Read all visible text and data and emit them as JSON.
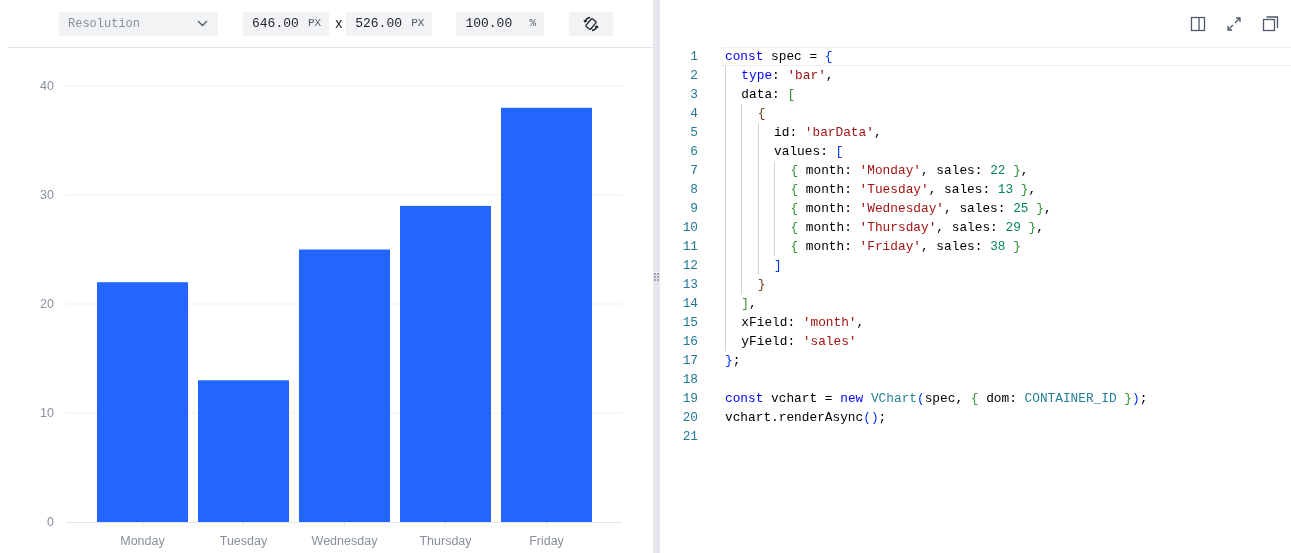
{
  "toolbar": {
    "resolution": {
      "placeholder": "Resolution"
    },
    "width": {
      "value": "646.00",
      "unit": "PX"
    },
    "separator": "x",
    "height": {
      "value": "526.00",
      "unit": "PX"
    },
    "zoom": {
      "value": "100.00",
      "unit": "%"
    }
  },
  "chart": {
    "chart_data": {
      "type": "bar",
      "categories": [
        "Monday",
        "Tuesday",
        "Wednesday",
        "Thursday",
        "Friday"
      ],
      "values": [
        22,
        13,
        25,
        29,
        38
      ],
      "ylim": [
        0,
        40
      ],
      "yticks": [
        0,
        10,
        20,
        30,
        40
      ],
      "grid": true
    }
  },
  "editor": {
    "lines": [
      {
        "number": "1",
        "active": true,
        "tokens": [
          {
            "text": "const",
            "kind": "k"
          },
          {
            "text": " spec = ",
            "kind": "p"
          },
          {
            "text": "{",
            "kind": "b1"
          }
        ]
      },
      {
        "number": "2",
        "active": false,
        "tokens": [
          {
            "text": "  type",
            "kind": "k"
          },
          {
            "text": ": ",
            "kind": "p"
          },
          {
            "text": "'bar'",
            "kind": "s"
          },
          {
            "text": ",",
            "kind": "p"
          }
        ]
      },
      {
        "number": "3",
        "active": false,
        "tokens": [
          {
            "text": "  data: ",
            "kind": "p"
          },
          {
            "text": "[",
            "kind": "b2"
          }
        ]
      },
      {
        "number": "4",
        "active": false,
        "tokens": [
          {
            "text": "    {",
            "kind": "b3"
          }
        ]
      },
      {
        "number": "5",
        "active": false,
        "tokens": [
          {
            "text": "      id: ",
            "kind": "p"
          },
          {
            "text": "'barData'",
            "kind": "s"
          },
          {
            "text": ",",
            "kind": "p"
          }
        ]
      },
      {
        "number": "6",
        "active": false,
        "tokens": [
          {
            "text": "      values: ",
            "kind": "p"
          },
          {
            "text": "[",
            "kind": "b1"
          }
        ]
      },
      {
        "number": "7",
        "active": false,
        "tokens": [
          {
            "text": "        {",
            "kind": "b2"
          },
          {
            "text": " month: ",
            "kind": "p"
          },
          {
            "text": "'Monday'",
            "kind": "s"
          },
          {
            "text": ", sales: ",
            "kind": "p"
          },
          {
            "text": "22",
            "kind": "n"
          },
          {
            "text": " }",
            "kind": "b2"
          },
          {
            "text": ",",
            "kind": "p"
          }
        ]
      },
      {
        "number": "8",
        "active": false,
        "tokens": [
          {
            "text": "        {",
            "kind": "b2"
          },
          {
            "text": " month: ",
            "kind": "p"
          },
          {
            "text": "'Tuesday'",
            "kind": "s"
          },
          {
            "text": ", sales: ",
            "kind": "p"
          },
          {
            "text": "13",
            "kind": "n"
          },
          {
            "text": " }",
            "kind": "b2"
          },
          {
            "text": ",",
            "kind": "p"
          }
        ]
      },
      {
        "number": "9",
        "active": false,
        "tokens": [
          {
            "text": "        {",
            "kind": "b2"
          },
          {
            "text": " month: ",
            "kind": "p"
          },
          {
            "text": "'Wednesday'",
            "kind": "s"
          },
          {
            "text": ", sales: ",
            "kind": "p"
          },
          {
            "text": "25",
            "kind": "n"
          },
          {
            "text": " }",
            "kind": "b2"
          },
          {
            "text": ",",
            "kind": "p"
          }
        ]
      },
      {
        "number": "10",
        "active": false,
        "tokens": [
          {
            "text": "        {",
            "kind": "b2"
          },
          {
            "text": " month: ",
            "kind": "p"
          },
          {
            "text": "'Thursday'",
            "kind": "s"
          },
          {
            "text": ", sales: ",
            "kind": "p"
          },
          {
            "text": "29",
            "kind": "n"
          },
          {
            "text": " }",
            "kind": "b2"
          },
          {
            "text": ",",
            "kind": "p"
          }
        ]
      },
      {
        "number": "11",
        "active": false,
        "tokens": [
          {
            "text": "        {",
            "kind": "b2"
          },
          {
            "text": " month: ",
            "kind": "p"
          },
          {
            "text": "'Friday'",
            "kind": "s"
          },
          {
            "text": ", sales: ",
            "kind": "p"
          },
          {
            "text": "38",
            "kind": "n"
          },
          {
            "text": " }",
            "kind": "b2"
          }
        ]
      },
      {
        "number": "12",
        "active": false,
        "tokens": [
          {
            "text": "      ]",
            "kind": "b1"
          }
        ]
      },
      {
        "number": "13",
        "active": false,
        "tokens": [
          {
            "text": "    }",
            "kind": "b3"
          }
        ]
      },
      {
        "number": "14",
        "active": false,
        "tokens": [
          {
            "text": "  ]",
            "kind": "b2"
          },
          {
            "text": ",",
            "kind": "p"
          }
        ]
      },
      {
        "number": "15",
        "active": false,
        "tokens": [
          {
            "text": "  xField: ",
            "kind": "p"
          },
          {
            "text": "'month'",
            "kind": "s"
          },
          {
            "text": ",",
            "kind": "p"
          }
        ]
      },
      {
        "number": "16",
        "active": false,
        "tokens": [
          {
            "text": "  yField: ",
            "kind": "p"
          },
          {
            "text": "'sales'",
            "kind": "s"
          }
        ]
      },
      {
        "number": "17",
        "active": false,
        "tokens": [
          {
            "text": "}",
            "kind": "b1"
          },
          {
            "text": ";",
            "kind": "p"
          }
        ]
      },
      {
        "number": "18",
        "active": false
      },
      {
        "number": "19",
        "active": false,
        "tokens": [
          {
            "text": "const",
            "kind": "k"
          },
          {
            "text": " vchart = ",
            "kind": "p"
          },
          {
            "text": "new ",
            "kind": "k"
          },
          {
            "text": "VChart",
            "kind": "t"
          },
          {
            "text": "(",
            "kind": "b1"
          },
          {
            "text": "spec, ",
            "kind": "p"
          },
          {
            "text": "{",
            "kind": "b2"
          },
          {
            "text": " dom: ",
            "kind": "p"
          },
          {
            "text": "CONTAINER_ID",
            "kind": "t"
          },
          {
            "text": " }",
            "kind": "b2"
          },
          {
            "text": ")",
            "kind": "b1"
          },
          {
            "text": ";",
            "kind": "p"
          }
        ]
      },
      {
        "number": "20",
        "active": false,
        "tokens": [
          {
            "text": "vchart.renderAsync",
            "kind": "p"
          },
          {
            "text": "()",
            "kind": "b1"
          },
          {
            "text": ";",
            "kind": "p"
          }
        ]
      },
      {
        "number": "21",
        "active": false
      }
    ]
  }
}
